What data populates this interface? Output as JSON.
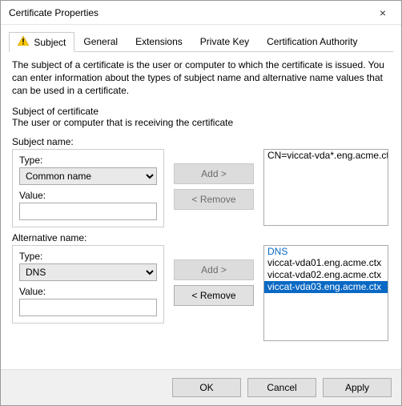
{
  "window": {
    "title": "Certificate Properties",
    "close_label": "×"
  },
  "tabs": {
    "subject": "Subject",
    "general": "General",
    "extensions": "Extensions",
    "private_key": "Private Key",
    "ca": "Certification Authority"
  },
  "text": {
    "description": "The subject of a certificate is the user or computer to which the certificate is issued. You can enter information about the types of subject name and alternative name values that can be used in a certificate.",
    "section_head": "Subject of certificate",
    "subdesc": "The user or computer that is receiving the certificate",
    "subject_name_label": "Subject name:",
    "alt_name_label": "Alternative name:",
    "type_label": "Type:",
    "value_label": "Value:"
  },
  "subject_name": {
    "type": "Common name",
    "value": ""
  },
  "alt_name": {
    "type": "DNS",
    "value": ""
  },
  "buttons": {
    "add": "Add >",
    "remove": "< Remove",
    "ok": "OK",
    "cancel": "Cancel",
    "apply": "Apply"
  },
  "subject_list": {
    "items": [
      "CN=viccat-vda*.eng.acme.ctx"
    ]
  },
  "alt_list": {
    "header": "DNS",
    "items": [
      {
        "label": "viccat-vda01.eng.acme.ctx",
        "selected": false
      },
      {
        "label": "viccat-vda02.eng.acme.ctx",
        "selected": false
      },
      {
        "label": "viccat-vda03.eng.acme.ctx",
        "selected": true
      }
    ]
  }
}
